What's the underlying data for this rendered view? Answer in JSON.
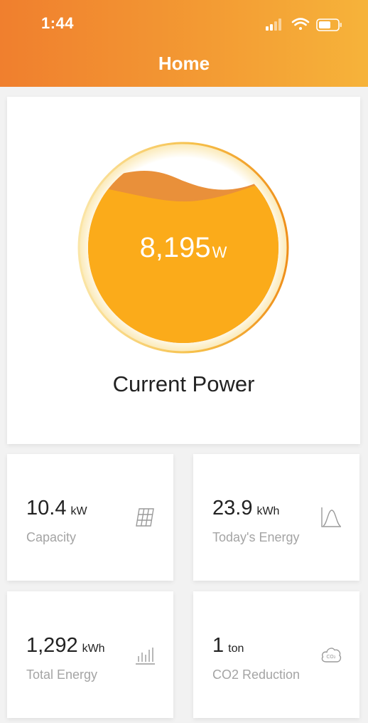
{
  "status_bar": {
    "time": "1:44",
    "icons": [
      "cellular-signal-icon",
      "wifi-icon",
      "battery-icon"
    ]
  },
  "header": {
    "title": "Home",
    "gradient": [
      "#f07f2e",
      "#f6b33a"
    ]
  },
  "current_power": {
    "value": "8,195",
    "unit": "W",
    "label": "Current Power",
    "fill_color": "#fbab1a"
  },
  "stats": [
    {
      "value": "10.4",
      "unit": "kW",
      "label": "Capacity",
      "icon": "solar-panel-icon"
    },
    {
      "value": "23.9",
      "unit": "kWh",
      "label": "Today's Energy",
      "icon": "curve-chart-icon"
    },
    {
      "value": "1,292",
      "unit": "kWh",
      "label": "Total Energy",
      "icon": "bar-chart-icon"
    },
    {
      "value": "1",
      "unit": "ton",
      "label": "CO2 Reduction",
      "icon": "co2-cloud-icon"
    }
  ]
}
